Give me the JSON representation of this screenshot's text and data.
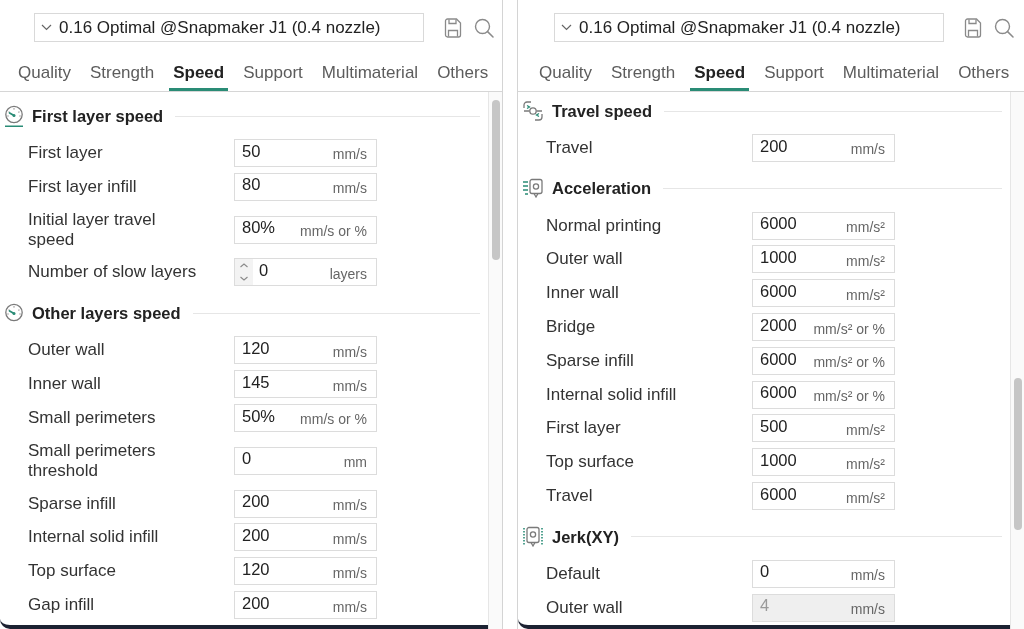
{
  "panels": [
    {
      "preset": {
        "value": "0.16 Optimal @Snapmaker J1 (0.4 nozzle)"
      },
      "tabs": [
        {
          "label": "Quality",
          "selected": false
        },
        {
          "label": "Strength",
          "selected": false
        },
        {
          "label": "Speed",
          "selected": true
        },
        {
          "label": "Support",
          "selected": false
        },
        {
          "label": "Multimaterial",
          "selected": false
        },
        {
          "label": "Others",
          "selected": false
        }
      ],
      "sections": [
        {
          "kind": "layer",
          "title": "First layer speed",
          "rows": [
            {
              "kind": "text",
              "label": "First layer",
              "value": "50",
              "unit": "mm/s",
              "disabled": false
            },
            {
              "kind": "text",
              "label": "First layer infill",
              "value": "80",
              "unit": "mm/s",
              "disabled": false
            },
            {
              "kind": "text",
              "label": "Initial layer travel speed",
              "value": "80%",
              "unit": "mm/s or %",
              "disabled": false
            },
            {
              "kind": "spin",
              "label": "Number of slow layers",
              "value": "0",
              "unit": "layers",
              "disabled": false
            }
          ]
        },
        {
          "kind": "speed",
          "title": "Other layers speed",
          "rows": [
            {
              "kind": "text",
              "label": "Outer wall",
              "value": "120",
              "unit": "mm/s",
              "disabled": false
            },
            {
              "kind": "text",
              "label": "Inner wall",
              "value": "145",
              "unit": "mm/s",
              "disabled": false
            },
            {
              "kind": "text",
              "label": "Small perimeters",
              "value": "50%",
              "unit": "mm/s or %",
              "disabled": false
            },
            {
              "kind": "text",
              "label": "Small perimeters threshold",
              "value": "0",
              "unit": "mm",
              "disabled": false
            },
            {
              "kind": "text",
              "label": "Sparse infill",
              "value": "200",
              "unit": "mm/s",
              "disabled": false
            },
            {
              "kind": "text",
              "label": "Internal solid infill",
              "value": "200",
              "unit": "mm/s",
              "disabled": false
            },
            {
              "kind": "text",
              "label": "Top surface",
              "value": "120",
              "unit": "mm/s",
              "disabled": false
            },
            {
              "kind": "text",
              "label": "Gap infill",
              "value": "200",
              "unit": "mm/s",
              "disabled": false
            }
          ]
        }
      ]
    },
    {
      "preset": {
        "value": "0.16 Optimal @Snapmaker J1 (0.4 nozzle)"
      },
      "tabs": [
        {
          "label": "Quality",
          "selected": false
        },
        {
          "label": "Strength",
          "selected": false
        },
        {
          "label": "Speed",
          "selected": true
        },
        {
          "label": "Support",
          "selected": false
        },
        {
          "label": "Multimaterial",
          "selected": false
        },
        {
          "label": "Others",
          "selected": false
        }
      ],
      "sections": [
        {
          "kind": "travel",
          "title": "Travel speed",
          "rows": [
            {
              "kind": "text",
              "label": "Travel",
              "value": "200",
              "unit": "mm/s",
              "disabled": false
            }
          ]
        },
        {
          "kind": "acceleration",
          "title": "Acceleration",
          "rows": [
            {
              "kind": "text",
              "label": "Normal printing",
              "value": "6000",
              "unit": "mm/s²",
              "disabled": false
            },
            {
              "kind": "text",
              "label": "Outer wall",
              "value": "1000",
              "unit": "mm/s²",
              "disabled": false
            },
            {
              "kind": "text",
              "label": "Inner wall",
              "value": "6000",
              "unit": "mm/s²",
              "disabled": false
            },
            {
              "kind": "text",
              "label": "Bridge",
              "value": "2000",
              "unit": "mm/s² or %",
              "disabled": false
            },
            {
              "kind": "text",
              "label": "Sparse infill",
              "value": "6000",
              "unit": "mm/s² or %",
              "disabled": false
            },
            {
              "kind": "text",
              "label": "Internal solid infill",
              "value": "6000",
              "unit": "mm/s² or %",
              "disabled": false
            },
            {
              "kind": "text",
              "label": "First layer",
              "value": "500",
              "unit": "mm/s²",
              "disabled": false
            },
            {
              "kind": "text",
              "label": "Top surface",
              "value": "1000",
              "unit": "mm/s²",
              "disabled": false
            },
            {
              "kind": "text",
              "label": "Travel",
              "value": "6000",
              "unit": "mm/s²",
              "disabled": false
            }
          ]
        },
        {
          "kind": "jerk",
          "title": "Jerk(XY)",
          "rows": [
            {
              "kind": "text",
              "label": "Default",
              "value": "0",
              "unit": "mm/s",
              "disabled": false
            },
            {
              "kind": "text",
              "label": "Outer wall",
              "value": "4",
              "unit": "mm/s",
              "disabled": true
            }
          ]
        }
      ]
    }
  ]
}
